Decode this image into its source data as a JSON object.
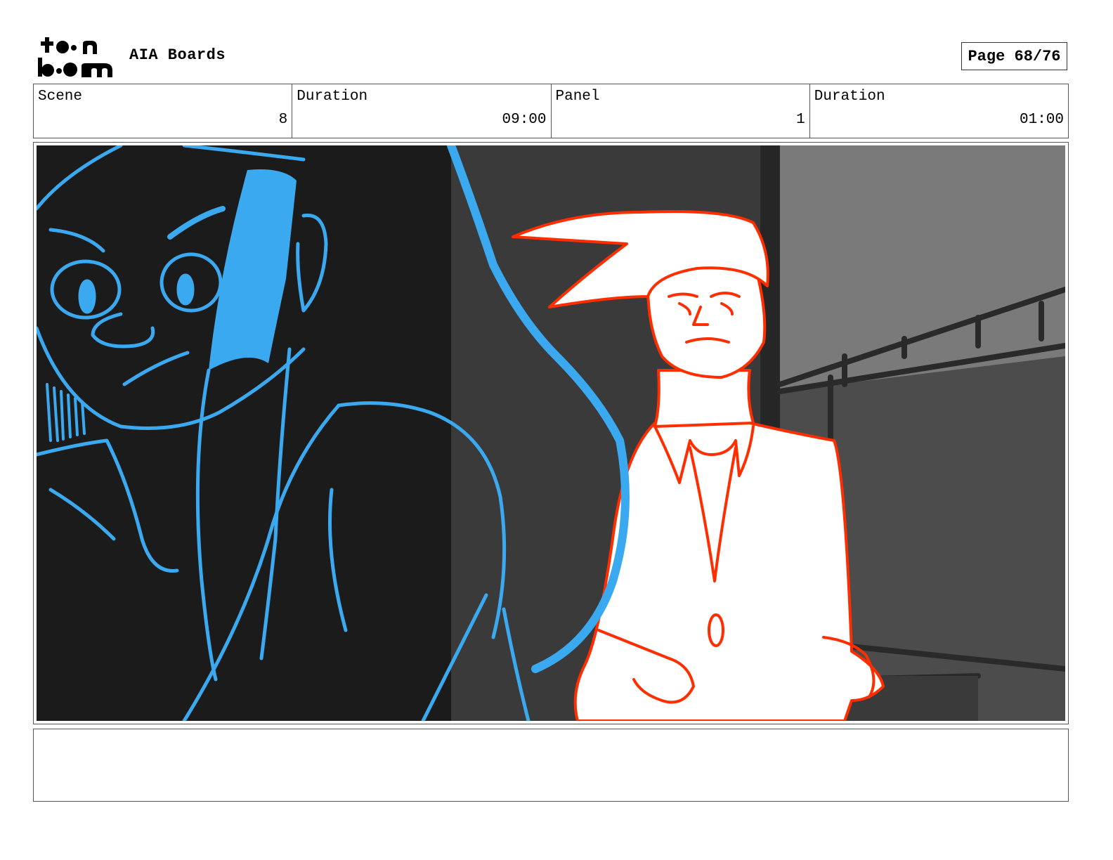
{
  "header": {
    "logo_text_top": "toon",
    "logo_text_bottom": "boom",
    "project_title": "AIA Boards",
    "page_label": "Page 68/76"
  },
  "info": {
    "scene_label": "Scene",
    "scene_value": "8",
    "scene_duration_label": "Duration",
    "scene_duration_value": "09:00",
    "panel_label": "Panel",
    "panel_value": "1",
    "panel_duration_label": "Duration",
    "panel_duration_value": "01:00"
  },
  "panel": {
    "colors": {
      "foreground_character": "#3aa9f0",
      "background_character": "#ff2e00",
      "dark_fill": "#1b1b1b",
      "wall_fill": "#555555",
      "light_wall": "#7a7a7a"
    }
  },
  "notes": {
    "text": ""
  }
}
